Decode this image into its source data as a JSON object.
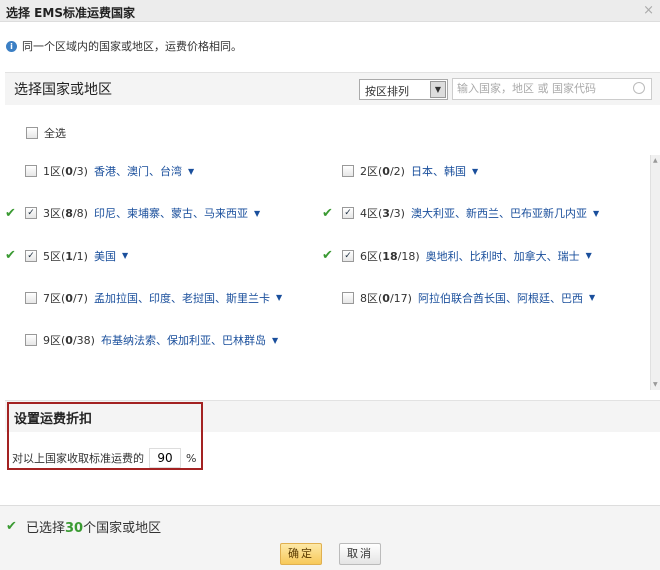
{
  "dialog": {
    "title": "选择 EMS标准运费国家",
    "close": "×"
  },
  "info": "同一个区域内的国家或地区，运费价格相同。",
  "section": {
    "title": "选择国家或地区",
    "sort_value": "按区排列",
    "search_placeholder": "输入国家，地区 或 国家代码"
  },
  "select_all": "全选",
  "zones": [
    {
      "label": "1区(",
      "sel": "0",
      "total": "/3)",
      "countries": "香港、澳门、台湾",
      "checked": false
    },
    {
      "label": "2区(",
      "sel": "0",
      "total": "/2)",
      "countries": "日本、韩国",
      "checked": false
    },
    {
      "label": "3区(",
      "sel": "8",
      "total": "/8)",
      "countries": "印尼、柬埔寨、蒙古、马来西亚",
      "checked": true
    },
    {
      "label": "4区(",
      "sel": "3",
      "total": "/3)",
      "countries": "澳大利亚、新西兰、巴布亚新几内亚",
      "checked": true
    },
    {
      "label": "5区(",
      "sel": "1",
      "total": "/1)",
      "countries": "美国",
      "checked": true
    },
    {
      "label": "6区(",
      "sel": "18",
      "total": "/18)",
      "countries": "奥地利、比利时、加拿大、瑞士",
      "checked": true
    },
    {
      "label": "7区(",
      "sel": "0",
      "total": "/7)",
      "countries": "孟加拉国、印度、老挝国、斯里兰卡",
      "checked": false
    },
    {
      "label": "8区(",
      "sel": "0",
      "total": "/17)",
      "countries": "阿拉伯联合酋长国、阿根廷、巴西",
      "checked": false
    },
    {
      "label": "9区(",
      "sel": "0",
      "total": "/38)",
      "countries": "布基纳法索、保加利亚、巴林群岛",
      "checked": false
    }
  ],
  "discount": {
    "title": "设置运费折扣",
    "label": "对以上国家收取标准运费的",
    "value": "90",
    "unit": "%"
  },
  "footer": {
    "prefix": "已选择",
    "count": "30",
    "suffix": "个国家或地区",
    "ok": "确定",
    "cancel": "取消"
  },
  "colors": {
    "accent": "#1a4f9c",
    "check": "#3a9a32",
    "highlight": "#a32222"
  }
}
